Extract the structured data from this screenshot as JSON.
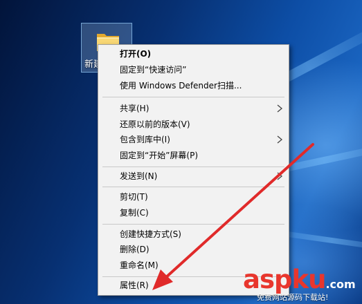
{
  "desktop": {
    "folder_label": "新建文件夹"
  },
  "context_menu": {
    "items": [
      {
        "label": "打开(O)",
        "bold": true,
        "submenu": false
      },
      {
        "label": "固定到“快速访问”",
        "bold": false,
        "submenu": false
      },
      {
        "label": "使用 Windows Defender扫描...",
        "bold": false,
        "submenu": false
      },
      {
        "label": "共享(H)",
        "bold": false,
        "submenu": true
      },
      {
        "label": "还原以前的版本(V)",
        "bold": false,
        "submenu": false
      },
      {
        "label": "包含到库中(I)",
        "bold": false,
        "submenu": true
      },
      {
        "label": "固定到“开始”屏幕(P)",
        "bold": false,
        "submenu": false
      },
      {
        "label": "发送到(N)",
        "bold": false,
        "submenu": true
      },
      {
        "label": "剪切(T)",
        "bold": false,
        "submenu": false
      },
      {
        "label": "复制(C)",
        "bold": false,
        "submenu": false
      },
      {
        "label": "创建快捷方式(S)",
        "bold": false,
        "submenu": false
      },
      {
        "label": "删除(D)",
        "bold": false,
        "submenu": false
      },
      {
        "label": "重命名(M)",
        "bold": false,
        "submenu": false
      },
      {
        "label": "属性(R)",
        "bold": false,
        "submenu": false
      }
    ]
  },
  "annotation": {
    "color": "#e02a2a",
    "points_to": "属性(R)"
  },
  "watermark": {
    "logo_text": "aspku",
    "logo_suffix": ".com",
    "subtitle": "免费网站源码下载站!",
    "color": "#e8362d"
  }
}
